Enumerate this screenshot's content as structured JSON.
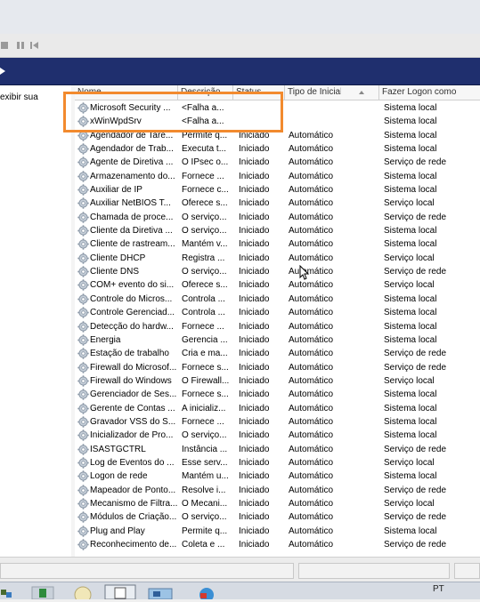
{
  "left_pane": {
    "text": "exibir sua"
  },
  "columns": {
    "name": "Nome",
    "description": "Descrição",
    "status": "Status",
    "startup_type": "Tipo de Inicialização",
    "logon_as": "Fazer Logon como"
  },
  "services": [
    {
      "name": "Microsoft Security ...",
      "description": "<Falha a...",
      "status": "",
      "startup_type": "",
      "logon_as": "Sistema local"
    },
    {
      "name": "xWinWpdSrv",
      "description": "<Falha a...",
      "status": "",
      "startup_type": "",
      "logon_as": "Sistema local"
    },
    {
      "name": "Agendador de Tare...",
      "description": "Permite q...",
      "status": "Iniciado",
      "startup_type": "Automático",
      "logon_as": "Sistema local"
    },
    {
      "name": "Agendador de Trab...",
      "description": "Executa t...",
      "status": "Iniciado",
      "startup_type": "Automático",
      "logon_as": "Sistema local"
    },
    {
      "name": "Agente de Diretiva ...",
      "description": "O IPsec o...",
      "status": "Iniciado",
      "startup_type": "Automático",
      "logon_as": "Serviço de rede"
    },
    {
      "name": "Armazenamento do...",
      "description": "Fornece ...",
      "status": "Iniciado",
      "startup_type": "Automático",
      "logon_as": "Sistema local"
    },
    {
      "name": "Auxiliar de IP",
      "description": "Fornece c...",
      "status": "Iniciado",
      "startup_type": "Automático",
      "logon_as": "Sistema local"
    },
    {
      "name": "Auxiliar NetBIOS T...",
      "description": "Oferece s...",
      "status": "Iniciado",
      "startup_type": "Automático",
      "logon_as": "Serviço local"
    },
    {
      "name": "Chamada de proce...",
      "description": "O serviço...",
      "status": "Iniciado",
      "startup_type": "Automático",
      "logon_as": "Serviço de rede"
    },
    {
      "name": "Cliente da Diretiva ...",
      "description": "O serviço...",
      "status": "Iniciado",
      "startup_type": "Automático",
      "logon_as": "Sistema local"
    },
    {
      "name": "Cliente de rastream...",
      "description": "Mantém v...",
      "status": "Iniciado",
      "startup_type": "Automático",
      "logon_as": "Sistema local"
    },
    {
      "name": "Cliente DHCP",
      "description": "Registra ...",
      "status": "Iniciado",
      "startup_type": "Automático",
      "logon_as": "Serviço local"
    },
    {
      "name": "Cliente DNS",
      "description": "O serviço...",
      "status": "Iniciado",
      "startup_type": "Automático",
      "logon_as": "Serviço de rede"
    },
    {
      "name": "COM+ evento do si...",
      "description": "Oferece s...",
      "status": "Iniciado",
      "startup_type": "Automático",
      "logon_as": "Serviço local"
    },
    {
      "name": "Controle do Micros...",
      "description": "Controla ...",
      "status": "Iniciado",
      "startup_type": "Automático",
      "logon_as": "Sistema local"
    },
    {
      "name": "Controle Gerenciad...",
      "description": "Controla ...",
      "status": "Iniciado",
      "startup_type": "Automático",
      "logon_as": "Sistema local"
    },
    {
      "name": "Detecção do hardw...",
      "description": "Fornece ...",
      "status": "Iniciado",
      "startup_type": "Automático",
      "logon_as": "Sistema local"
    },
    {
      "name": "Energia",
      "description": "Gerencia ...",
      "status": "Iniciado",
      "startup_type": "Automático",
      "logon_as": "Sistema local"
    },
    {
      "name": "Estação de trabalho",
      "description": "Cria e ma...",
      "status": "Iniciado",
      "startup_type": "Automático",
      "logon_as": "Serviço de rede"
    },
    {
      "name": "Firewall do Microsof...",
      "description": "Fornece s...",
      "status": "Iniciado",
      "startup_type": "Automático",
      "logon_as": "Serviço de rede"
    },
    {
      "name": "Firewall do Windows",
      "description": "O Firewall...",
      "status": "Iniciado",
      "startup_type": "Automático",
      "logon_as": "Serviço local"
    },
    {
      "name": "Gerenciador de Ses...",
      "description": "Fornece s...",
      "status": "Iniciado",
      "startup_type": "Automático",
      "logon_as": "Sistema local"
    },
    {
      "name": "Gerente de Contas ...",
      "description": "A inicializ...",
      "status": "Iniciado",
      "startup_type": "Automático",
      "logon_as": "Sistema local"
    },
    {
      "name": "Gravador VSS do S...",
      "description": "Fornece ...",
      "status": "Iniciado",
      "startup_type": "Automático",
      "logon_as": "Sistema local"
    },
    {
      "name": "Inicializador de Pro...",
      "description": "O serviço...",
      "status": "Iniciado",
      "startup_type": "Automático",
      "logon_as": "Sistema local"
    },
    {
      "name": "ISASTGCTRL",
      "description": "Instância ...",
      "status": "Iniciado",
      "startup_type": "Automático",
      "logon_as": "Serviço de rede"
    },
    {
      "name": "Log de Eventos do ...",
      "description": "Esse serv...",
      "status": "Iniciado",
      "startup_type": "Automático",
      "logon_as": "Serviço local"
    },
    {
      "name": "Logon de rede",
      "description": "Mantém u...",
      "status": "Iniciado",
      "startup_type": "Automático",
      "logon_as": "Sistema local"
    },
    {
      "name": "Mapeador de Ponto...",
      "description": "Resolve i...",
      "status": "Iniciado",
      "startup_type": "Automático",
      "logon_as": "Serviço de rede"
    },
    {
      "name": "Mecanismo de Filtra...",
      "description": "O Mecani...",
      "status": "Iniciado",
      "startup_type": "Automático",
      "logon_as": "Serviço local"
    },
    {
      "name": "Módulos de Criação...",
      "description": "O serviço...",
      "status": "Iniciado",
      "startup_type": "Automático",
      "logon_as": "Serviço de rede"
    },
    {
      "name": "Plug and Play",
      "description": "Permite q...",
      "status": "Iniciado",
      "startup_type": "Automático",
      "logon_as": "Sistema local"
    },
    {
      "name": "Reconhecimento de...",
      "description": "Coleta e ...",
      "status": "Iniciado",
      "startup_type": "Automático",
      "logon_as": "Serviço de rede"
    }
  ],
  "taskbar": {
    "language": "PT"
  },
  "colors": {
    "highlight": "#f28a2e",
    "titlebar": "#1f2f6e"
  }
}
